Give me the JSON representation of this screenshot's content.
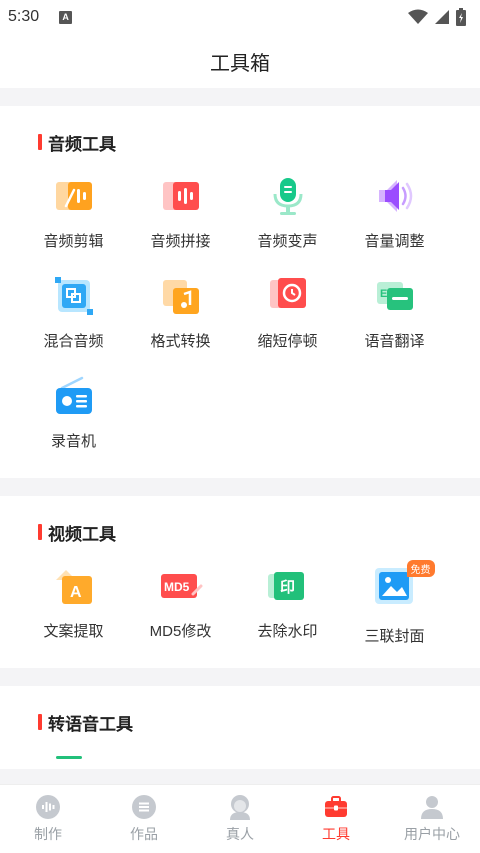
{
  "status_bar": {
    "time": "5:30",
    "notification_letter": "A"
  },
  "header": {
    "title": "工具箱"
  },
  "sections": [
    {
      "title": "音频工具",
      "tools": [
        {
          "label": "音频剪辑",
          "icon": "audio-cut-icon"
        },
        {
          "label": "音频拼接",
          "icon": "audio-join-icon"
        },
        {
          "label": "音频变声",
          "icon": "voice-change-icon"
        },
        {
          "label": "音量调整",
          "icon": "volume-adjust-icon"
        },
        {
          "label": "混合音频",
          "icon": "mix-audio-icon"
        },
        {
          "label": "格式转换",
          "icon": "format-convert-icon"
        },
        {
          "label": "缩短停顿",
          "icon": "shorten-pause-icon"
        },
        {
          "label": "语音翻译",
          "icon": "voice-translate-icon"
        },
        {
          "label": "录音机",
          "icon": "radio-recorder-icon"
        }
      ]
    },
    {
      "title": "视频工具",
      "tools": [
        {
          "label": "文案提取",
          "icon": "text-extract-icon"
        },
        {
          "label": "MD5修改",
          "icon": "md5-edit-icon",
          "icon_text": "MD5"
        },
        {
          "label": "去除水印",
          "icon": "remove-watermark-icon",
          "icon_text": "印"
        },
        {
          "label": "三联封面",
          "icon": "triple-cover-icon",
          "badge": "免费"
        }
      ]
    },
    {
      "title": "转语音工具",
      "tools": []
    }
  ],
  "tab_bar": {
    "items": [
      {
        "label": "制作",
        "icon": "waveform-icon",
        "active": false
      },
      {
        "label": "作品",
        "icon": "list-icon",
        "active": false
      },
      {
        "label": "真人",
        "icon": "person-face-icon",
        "active": false
      },
      {
        "label": "工具",
        "icon": "toolbox-icon",
        "active": true
      },
      {
        "label": "用户中心",
        "icon": "user-icon",
        "active": false
      }
    ]
  },
  "colors": {
    "accent": "#ff3b30",
    "inactive": "#9aa0a6",
    "badge": "#ff7a2e"
  }
}
